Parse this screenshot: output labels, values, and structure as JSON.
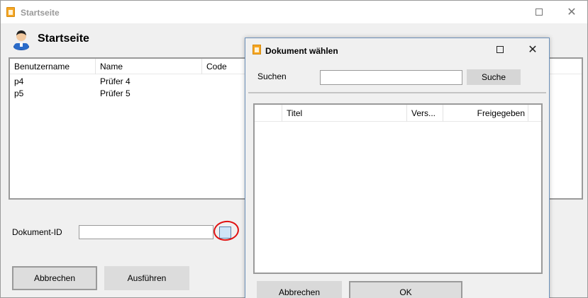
{
  "main": {
    "window_title": "Startseite",
    "page_title": "Startseite",
    "table": {
      "columns": [
        "Benutzername",
        "Name",
        "Code"
      ],
      "rows": [
        [
          "p4",
          "Prüfer 4"
        ],
        [
          "p5",
          "Prüfer 5"
        ]
      ]
    },
    "document_id_label": "Dokument-ID",
    "document_id_value": "",
    "cancel_label": "Abbrechen",
    "run_label": "Ausführen"
  },
  "dialog": {
    "title": "Dokument wählen",
    "search_label": "Suchen",
    "search_value": "",
    "search_button": "Suche",
    "columns": [
      "",
      "Titel",
      "Vers...",
      "Freigegeben"
    ],
    "cancel_label": "Abbrechen",
    "ok_label": "OK"
  },
  "colors": {
    "highlight": "#e01010",
    "app_icon": "#f6a623"
  },
  "icons": {
    "app": "document-app-icon",
    "user": "user-avatar-icon",
    "maximize": "maximize-icon",
    "close": "close-icon"
  }
}
